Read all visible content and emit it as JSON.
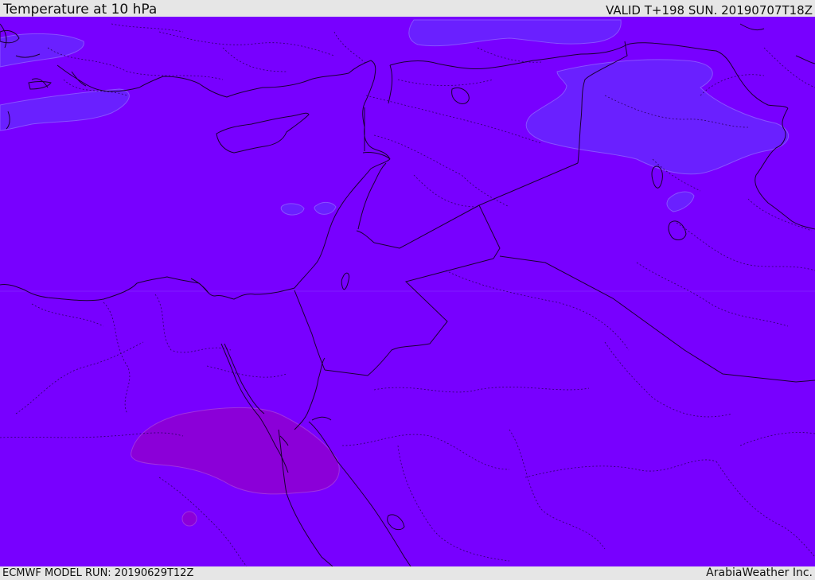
{
  "header": {
    "title": "Temperature at 10 hPa",
    "valid": "VALID T+198 SUN. 20190707T18Z"
  },
  "footer": {
    "model_run": "ECMWF MODEL RUN: 20190629T12Z",
    "credit": "ArabiaWeather Inc."
  },
  "map": {
    "base_color": "#7800ff",
    "cold_patch_color": "#6a22ff",
    "warm_patch_color": "#8b00d8",
    "coastline_color": "#1a0033",
    "border_color": "#1a0033"
  }
}
